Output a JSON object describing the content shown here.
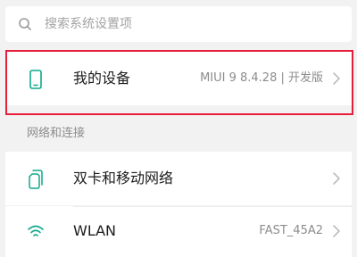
{
  "search": {
    "placeholder": "搜索系统设置项",
    "icon": "search-icon"
  },
  "device_row": {
    "label": "我的设备",
    "value": "MIUI 9 8.4.28 | 开发版",
    "icon": "phone-icon",
    "highlight_color": "#e61e3c"
  },
  "section": {
    "network_header": "网络和连接"
  },
  "network_items": [
    {
      "label": "双卡和移动网络",
      "value": "",
      "icon": "dual-sim-icon"
    },
    {
      "label": "WLAN",
      "value": "FAST_45A2",
      "icon": "wifi-icon"
    }
  ],
  "colors": {
    "accent": "#11a88a",
    "background": "#f2f2f2",
    "card": "#ffffff"
  }
}
